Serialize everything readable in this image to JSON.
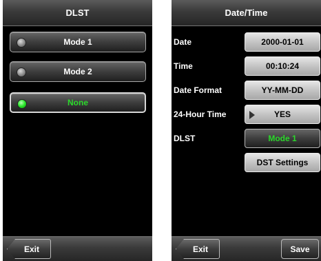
{
  "left_screen": {
    "title": "DLST",
    "modes": [
      {
        "label": "Mode 1",
        "selected": false
      },
      {
        "label": "Mode 2",
        "selected": false
      },
      {
        "label": "None",
        "selected": true
      }
    ],
    "exit_label": "Exit"
  },
  "right_screen": {
    "title": "Date/Time",
    "rows": [
      {
        "label": "Date",
        "value": "2000-01-01"
      },
      {
        "label": "Time",
        "value": "00:10:24"
      },
      {
        "label": "Date Format",
        "value": "YY-MM-DD"
      },
      {
        "label": "24-Hour Time",
        "value": "YES"
      },
      {
        "label": "DLST",
        "value": "Mode 1"
      }
    ],
    "dst_settings_label": "DST Settings",
    "exit_label": "Exit",
    "save_label": "Save"
  },
  "colors": {
    "selected_text": "#2bd82b",
    "screen_bg": "#000000",
    "value_button": "#c4c4c4"
  }
}
